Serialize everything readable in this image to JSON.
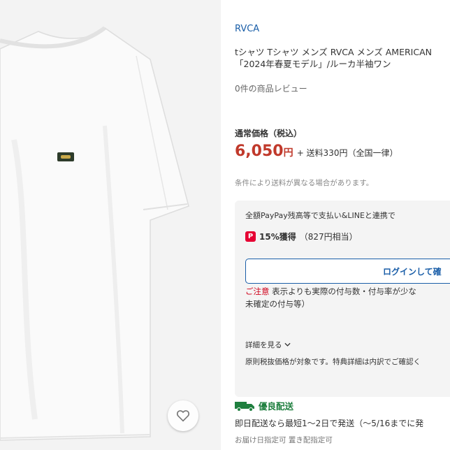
{
  "product": {
    "brand": "RVCA",
    "title_line1": "tシャツ Tシャツ メンズ RVCA メンズ AMERICAN",
    "title_line2": "「2024年春夏モデル」/ルーカ半袖ワン",
    "reviews": "0件の商品レビュー",
    "image_alt": "white t-shirt"
  },
  "price": {
    "label": "通常価格（税込）",
    "amount": "6,050",
    "currency": "円",
    "shipping": "+ 送料330円（全国一律）",
    "note": "条件により送料が異なる場合があります。"
  },
  "paypay": {
    "line1": "全額PayPay残高等で支払い&LINEと連携で",
    "percent": "15%獲得",
    "equivalent": "（827円相当）",
    "login_button": "ログインして確",
    "caution_label": "ご注意",
    "caution_text": "表示よりも実際の付与数・付与率が少な",
    "caution_text2": "未確定の付与等）",
    "details": "詳細を見る",
    "basis": "原則税抜価格が対象です。特典詳細は内訳でご確認く"
  },
  "delivery": {
    "label": "優良配送",
    "text": "即日配送なら最短1〜2日で発送（〜5/16までに発",
    "sub": "お届け日指定可  置き配指定可"
  },
  "colors": {
    "brand_link": "#1a5ea8",
    "price_red": "#c0392b",
    "delivery_green": "#1f7f3f",
    "paypay_red": "#e60033"
  }
}
